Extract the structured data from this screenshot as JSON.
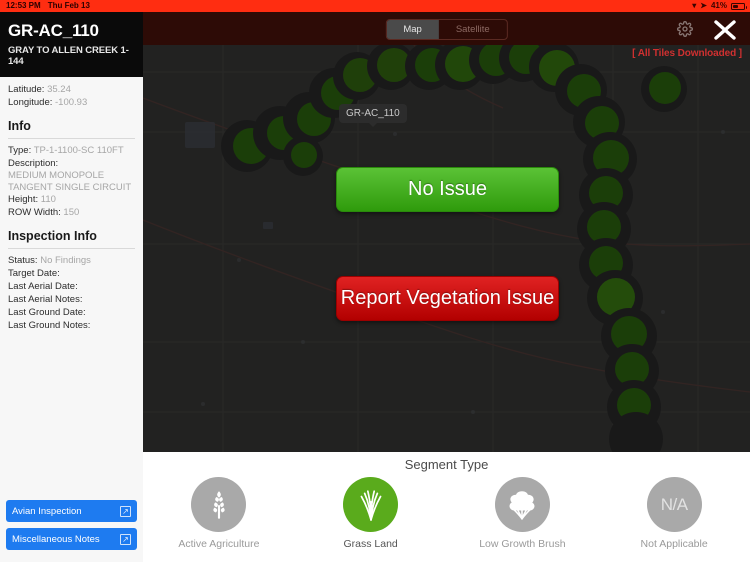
{
  "statusbar": {
    "time": "12:53 PM",
    "date": "Thu Feb 13",
    "wifi_icon": "wifi-icon",
    "location_icon": "location-arrow-icon",
    "battery_percent": "41%",
    "battery_icon": "battery-icon"
  },
  "sidebar": {
    "title": "GR-AC_110",
    "subtitle": "GRAY TO ALLEN CREEK 1-144",
    "coords": {
      "latitude_label": "Latitude:",
      "latitude_value": "35.24",
      "longitude_label": "Longitude:",
      "longitude_value": "-100.93"
    },
    "info": {
      "heading": "Info",
      "type_label": "Type:",
      "type_value": "TP-1-1100-SC 110FT",
      "description_label": "Description:",
      "description_value": "MEDIUM MONOPOLE TANGENT SINGLE CIRCUIT",
      "height_label": "Height:",
      "height_value": "110",
      "row_width_label": "ROW Width:",
      "row_width_value": "150"
    },
    "inspection": {
      "heading": "Inspection Info",
      "status_label": "Status:",
      "status_value": "No Findings",
      "target_date_label": "Target Date:",
      "target_date_value": "",
      "last_aerial_date_label": "Last Aerial Date:",
      "last_aerial_date_value": "",
      "last_aerial_notes_label": "Last Aerial Notes:",
      "last_aerial_notes_value": "",
      "last_ground_date_label": "Last Ground Date:",
      "last_ground_date_value": "",
      "last_ground_notes_label": "Last Ground Notes:",
      "last_ground_notes_value": ""
    },
    "actions": [
      {
        "label": "Avian Inspection",
        "icon": "external-link-icon"
      },
      {
        "label": "Miscellaneous Notes",
        "icon": "external-link-icon"
      }
    ]
  },
  "mapbar": {
    "map_tab": "Map",
    "satellite_tab": "Satellite",
    "selected_tab": "Map",
    "settings_icon": "gear-icon",
    "close_icon": "close-icon"
  },
  "map": {
    "tiles_badge": "[ All Tiles Downloaded ]",
    "callout_label": "GR-AC_110",
    "primary_button": "No Issue",
    "secondary_button": "Report Vegetation Issue",
    "colors": {
      "primary_button": "#3aa40f",
      "secondary_button": "#cc1111",
      "segment_marker": "#2f6b10"
    }
  },
  "bottom": {
    "title": "Segment Type",
    "options": [
      {
        "label": "Active Agriculture",
        "icon": "wheat-icon",
        "selected": false
      },
      {
        "label": "Grass Land",
        "icon": "grass-icon",
        "selected": true
      },
      {
        "label": "Low Growth Brush",
        "icon": "bush-icon",
        "selected": false
      },
      {
        "label": "Not Applicable",
        "icon": "na-text-icon",
        "selected": false,
        "glyph": "N/A"
      }
    ],
    "selected_color": "#5aab1c"
  }
}
